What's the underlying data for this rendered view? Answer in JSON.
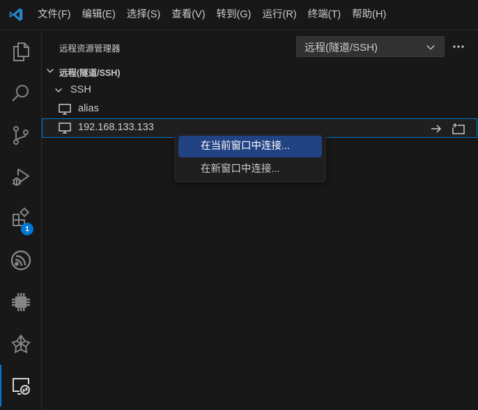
{
  "menubar": {
    "items": [
      "文件(F)",
      "编辑(E)",
      "选择(S)",
      "查看(V)",
      "转到(G)",
      "运行(R)",
      "终端(T)",
      "帮助(H)"
    ]
  },
  "activitybar": {
    "icons": [
      "explorer-icon",
      "search-icon",
      "source-control-icon",
      "run-debug-icon",
      "extensions-icon",
      "espressif-icon",
      "chip-icon",
      "platform-icon",
      "remote-explorer-icon"
    ],
    "extensions_badge": "1",
    "accent": "#0078d4"
  },
  "sidebar": {
    "title": "远程资源管理器",
    "selector_value": "远程(隧道/SSH)",
    "section_title": "远程(隧道/SSH)",
    "group_label": "SSH",
    "hosts": [
      {
        "label": "alias"
      },
      {
        "label": "192.168.133.133"
      }
    ]
  },
  "context_menu": {
    "items": [
      "在当前窗口中连接...",
      "在新窗口中连接..."
    ]
  },
  "colors": {
    "background": "#181818",
    "accent": "#0078d4",
    "menu_highlight": "#214283",
    "text": "#cccccc"
  }
}
